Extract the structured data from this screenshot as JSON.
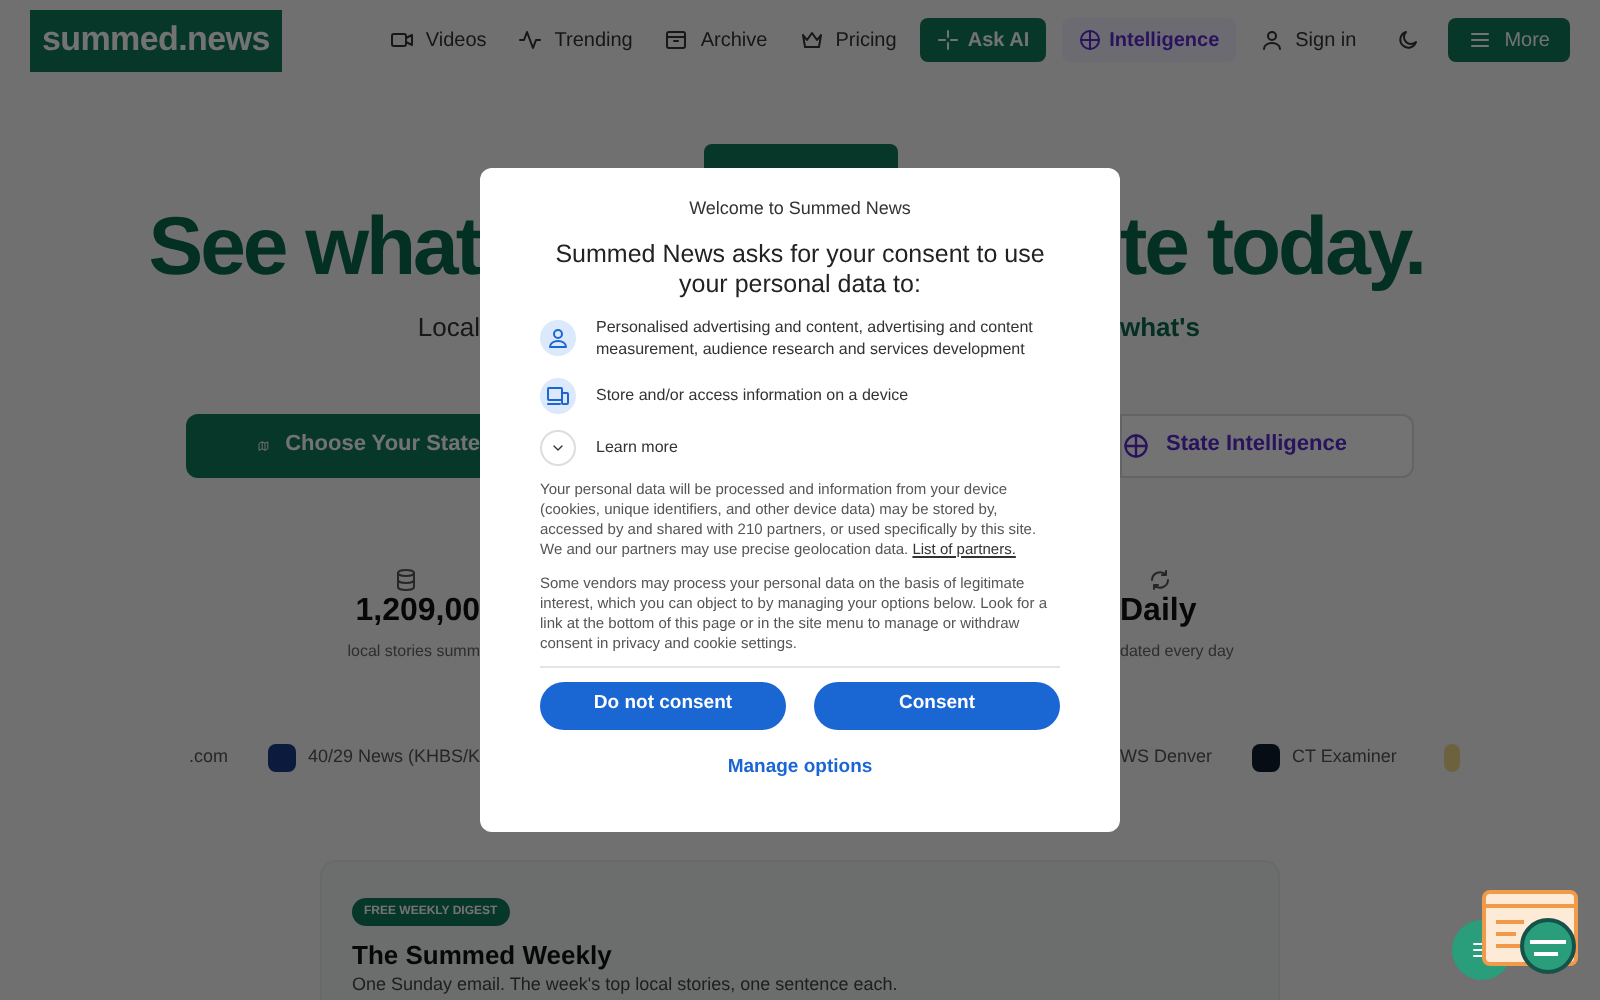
{
  "header": {
    "logo": "summed.news",
    "nav": [
      "Videos",
      "Trending",
      "Archive",
      "Pricing"
    ],
    "ask_ai": "Ask AI",
    "intelligence": "Intelligence",
    "sign_in": "Sign in",
    "more": "More"
  },
  "hero": {
    "title_left": "See what",
    "title_right": "te today.",
    "subtitle_left": "Local",
    "subtitle_right": "what's",
    "choose_button": "Choose Your State",
    "intelligence_button": "State Intelligence"
  },
  "stats": [
    {
      "value": "1,209,00",
      "label": "local stories summ"
    },
    {
      "value": "Daily",
      "label": "dated every day"
    }
  ],
  "sources": [
    ".com",
    "40/29 News (KHBS/K",
    "WS Denver",
    "CT Examiner"
  ],
  "consent_dialog": {
    "welcome": "Welcome to Summed News",
    "heading": "Summed News asks for your consent to use your personal data to:",
    "purposes": [
      "Personalised advertising and content, advertising and content measurement, audience research and services development",
      "Store and/or access information on a device"
    ],
    "learn_more": "Learn more",
    "paragraph_1": "Your personal data will be processed and information from your device (cookies, unique identifiers, and other device data) may be stored by, accessed by and shared with 210 partners, or used specifically by this site. We and our partners may use precise geolocation data.",
    "partners_link": "List of partners.",
    "paragraph_2": "Some vendors may process your personal data on the basis of legitimate interest, which you can object to by managing your options below. Look for a link at the bottom of this page or in the site menu to manage or withdraw consent in privacy and cookie settings.",
    "buttons": [
      "Do not consent",
      "Consent"
    ],
    "manage": "Manage options"
  },
  "digest": {
    "badge": "FREE WEEKLY DIGEST",
    "title": "The Summed Weekly",
    "text": "One Sunday email. The week's top local stories, one sentence each."
  }
}
